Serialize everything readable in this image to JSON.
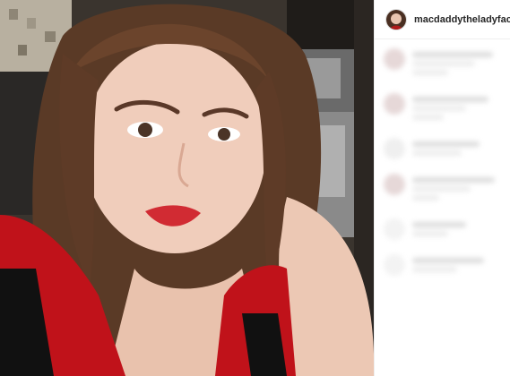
{
  "post": {
    "username": "macdaddytheladyface",
    "more_symbol": "•"
  },
  "icons": {
    "avatar": "profile-avatar",
    "more": "more-options-dot"
  },
  "colors": {
    "username_text": "#262626",
    "lip": "#d12b33",
    "shirt_red": "#c0121a"
  }
}
